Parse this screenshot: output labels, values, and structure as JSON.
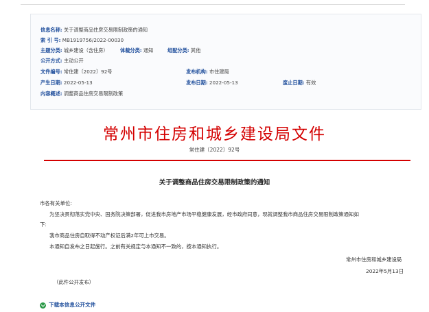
{
  "meta": {
    "info_name_label": "信息名称:",
    "info_name_value": "关于调整商品住房交易限制政策的通知",
    "index_label": "索 引 号:",
    "index_value": "MB1919756/2022-00030",
    "topic_label": "主题分类:",
    "topic_value": "城乡建设（含住房）",
    "genre_label": "体裁分类:",
    "genre_value": "通知",
    "org_cat_label": "组配分类:",
    "org_cat_value": "其他",
    "open_mode_label": "公开方式:",
    "open_mode_value": "主动公开",
    "doc_no_label": "文件编号:",
    "doc_no_value": "常住建〔2022〕92号",
    "issuer_label": "发布机构:",
    "issuer_value": "市住建局",
    "created_label": "产生日期:",
    "created_value": "2022-05-13",
    "published_label": "发布日期:",
    "published_value": "2022-05-13",
    "expire_label": "废止日期:",
    "expire_value": "有效",
    "summary_label": "内容概述:",
    "summary_value": "调整商品住房交易限制政策"
  },
  "header": {
    "red_title": "常州市住房和城乡建设局文件",
    "doc_number": "常住建〔2022〕92号"
  },
  "notice": {
    "title": "关于调整商品住房交易限制政策的通知",
    "salutation": "市各有关单位:",
    "para1_line1": "为坚决贯彻落实党中央、国务院决策部署，促进我市房地产市场平稳健康发展，经市政府同意，现就调整我市商品住房交易限制政策通知如",
    "para1_line2": "下:",
    "para2": "我市商品住房自取得不动产权证后满2年可上市交易。",
    "para3": "本通知自发布之日起施行。之前有关规定与本通知不一致的，按本通知执行。",
    "signer": "常州市住房和城乡建设局",
    "date": "2022年5月13日",
    "public_note": "（此件公开发布）"
  },
  "download": {
    "label": "下载本信息公开文件"
  }
}
